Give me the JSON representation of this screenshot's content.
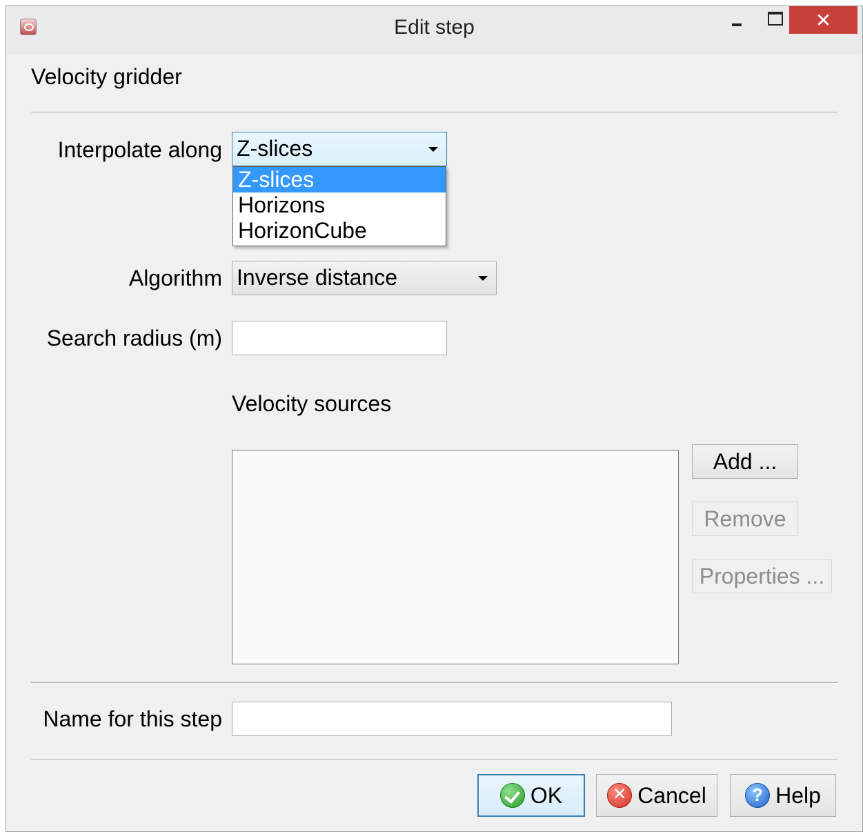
{
  "window": {
    "title": "Edit step",
    "close_glyph": "✕"
  },
  "heading": "Velocity gridder",
  "interpolate": {
    "label": "Interpolate along",
    "value": "Z-slices",
    "options": [
      "Z-slices",
      "Horizons",
      "HorizonCube"
    ]
  },
  "algorithm": {
    "label": "Algorithm",
    "value": "Inverse distance"
  },
  "search_radius": {
    "label": "Search radius (m)",
    "value": ""
  },
  "sources": {
    "label": "Velocity sources",
    "add": "Add ...",
    "remove": "Remove",
    "properties": "Properties ..."
  },
  "step_name": {
    "label": "Name for this step",
    "value": ""
  },
  "footer": {
    "ok": "OK",
    "cancel": "Cancel",
    "help": "Help",
    "cancel_glyph": "✕",
    "help_glyph": "?"
  },
  "icons": {
    "app": "app-logo-icon",
    "ok": "check-icon",
    "cancel": "cancel-icon",
    "help": "help-icon"
  }
}
